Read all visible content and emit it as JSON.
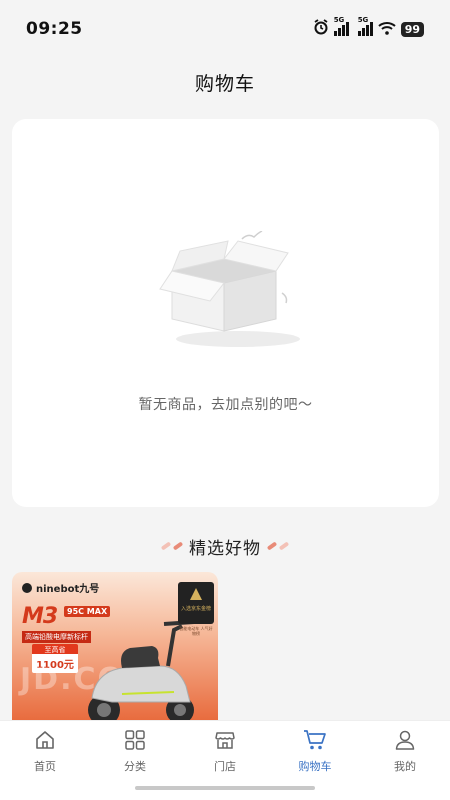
{
  "status_bar": {
    "time": "09:25",
    "signal1_label": "5G",
    "signal2_label": "5G",
    "battery": "99",
    "icons": [
      "alarm-icon",
      "signal-icon",
      "signal-icon",
      "wifi-icon",
      "battery-icon"
    ]
  },
  "header": {
    "title": "购物车"
  },
  "empty_cart": {
    "illustration": "empty-box-icon",
    "message": "暂无商品，去加点别的吧～"
  },
  "recommend": {
    "title": "精选好物",
    "products": [
      {
        "brand": "ninebot九号",
        "model": "M3",
        "model_tag": "95C MAX",
        "slogan": "高端铅酸电摩新标杆",
        "badge": "至高省",
        "price": "1100元",
        "corner_badge": "入选京东金榜",
        "corner_sub": "智能电动车 人气好物榜",
        "watermark": "JD.COM"
      }
    ]
  },
  "tab_bar": {
    "tabs": [
      {
        "label": "首页",
        "icon": "home-icon",
        "active": false
      },
      {
        "label": "分类",
        "icon": "grid-icon",
        "active": false
      },
      {
        "label": "门店",
        "icon": "store-icon",
        "active": false
      },
      {
        "label": "购物车",
        "icon": "cart-icon",
        "active": true
      },
      {
        "label": "我的",
        "icon": "user-icon",
        "active": false
      }
    ]
  },
  "colors": {
    "accent": "#3b73c4",
    "background": "#f4f4f4",
    "card": "#ffffff",
    "text_muted": "#666666"
  }
}
